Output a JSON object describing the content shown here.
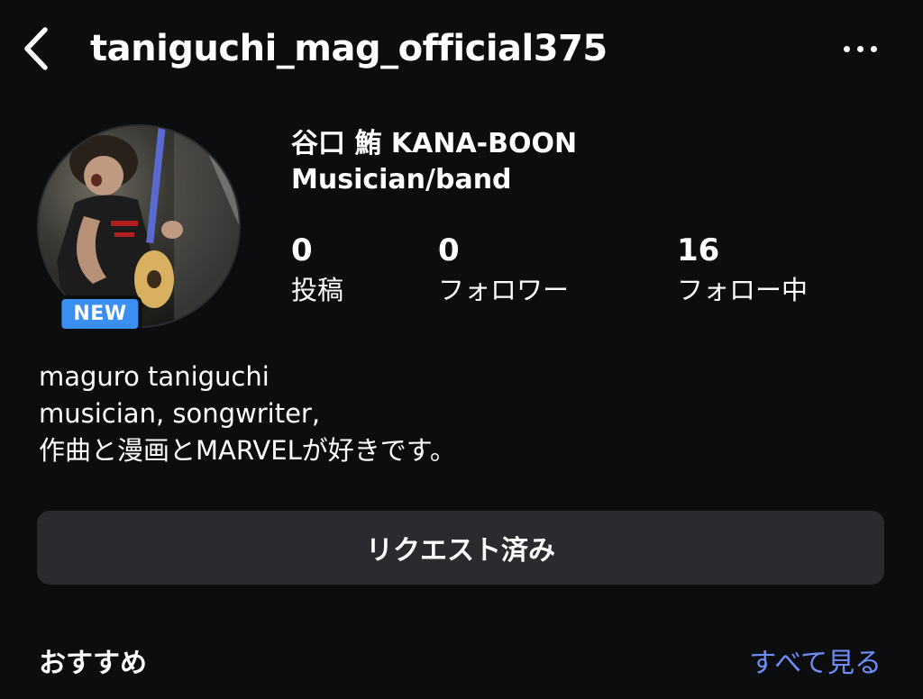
{
  "header": {
    "username": "taniguchi_mag_official375",
    "back_icon": "chevron-left-icon",
    "more_icon": "ellipsis-horizontal-icon"
  },
  "profile": {
    "badge": "NEW",
    "display_name": "谷口 鮪 KANA-BOON",
    "category": "Musician/band",
    "stats": [
      {
        "value": "0",
        "label": "投稿"
      },
      {
        "value": "0",
        "label": "フォロワー"
      },
      {
        "value": "16",
        "label": "フォロー中"
      }
    ],
    "bio_lines": [
      "maguro taniguchi",
      "musician, songwriter,",
      "作曲と漫画とMARVELが好きです。"
    ]
  },
  "actions": {
    "request_label": "リクエスト済み"
  },
  "suggestions": {
    "title": "おすすめ",
    "see_all": "すべて見る"
  },
  "colors": {
    "background": "#0c0d0f",
    "button_bg": "#2a2b2f",
    "badge_bg": "#3a8ff0",
    "link": "#6f8ef5"
  }
}
